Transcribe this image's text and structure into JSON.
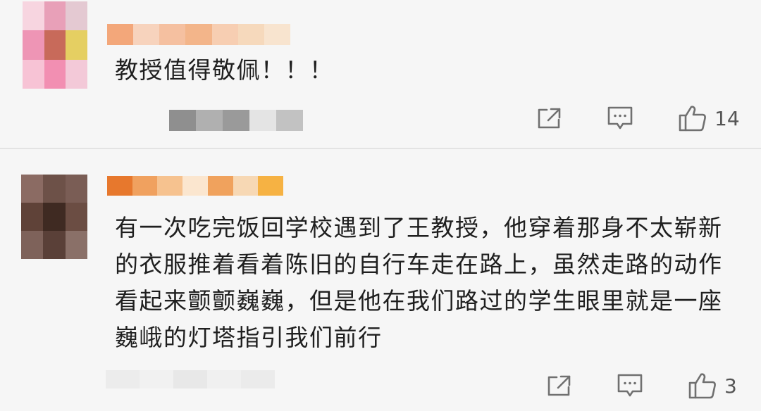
{
  "comments": [
    {
      "text": "教授值得敬佩！！！",
      "likes": "14",
      "avatar_colors": [
        "#f7d5e0",
        "#e8a0b8",
        "#e4c9d2",
        "#ee95b5",
        "#c86a5a",
        "#e5cf62",
        "#f7c3d5",
        "#f28fb2",
        "#f3c9d8"
      ],
      "nickname_colors": [
        "#f3a77a",
        "#f7d3bd",
        "#f5c0a0",
        "#f3b58a",
        "#f7ceb2",
        "#f6d9bc",
        "#f8e4cf"
      ],
      "meta_colors": [
        "#8f8f8f",
        "#b0b0b0",
        "#9a9a9a",
        "#e4e4e4",
        "#c2c2c2"
      ]
    },
    {
      "text": "有一次吃完饭回学校遇到了王教授，他穿着那身不太崭新的衣服推着看着陈旧的自行车走在路上，虽然走路的动作看起来颤颤巍巍，但是他在我们路过的学生眼里就是一座巍峨的灯塔指引我们前行",
      "likes": "3",
      "avatar_colors": [
        "#8b6b63",
        "#6d5148",
        "#7a5d55",
        "#5f4238",
        "#3f2a22",
        "#6b4d43",
        "#7e625a",
        "#5a4038",
        "#8a7068"
      ],
      "nickname_colors": [
        "#e7782d",
        "#f0a15f",
        "#f6c28f",
        "#fbe6cf",
        "#f0a25d",
        "#f7d8b4",
        "#f6b243"
      ],
      "meta_colors": [
        "#ececec",
        "#f1f1f1",
        "#e8e8e8",
        "#f0f0f0",
        "#ebebeb"
      ]
    }
  ],
  "icons": {
    "share": "share-icon",
    "reply": "reply-icon",
    "like": "thumbs-up-icon"
  }
}
